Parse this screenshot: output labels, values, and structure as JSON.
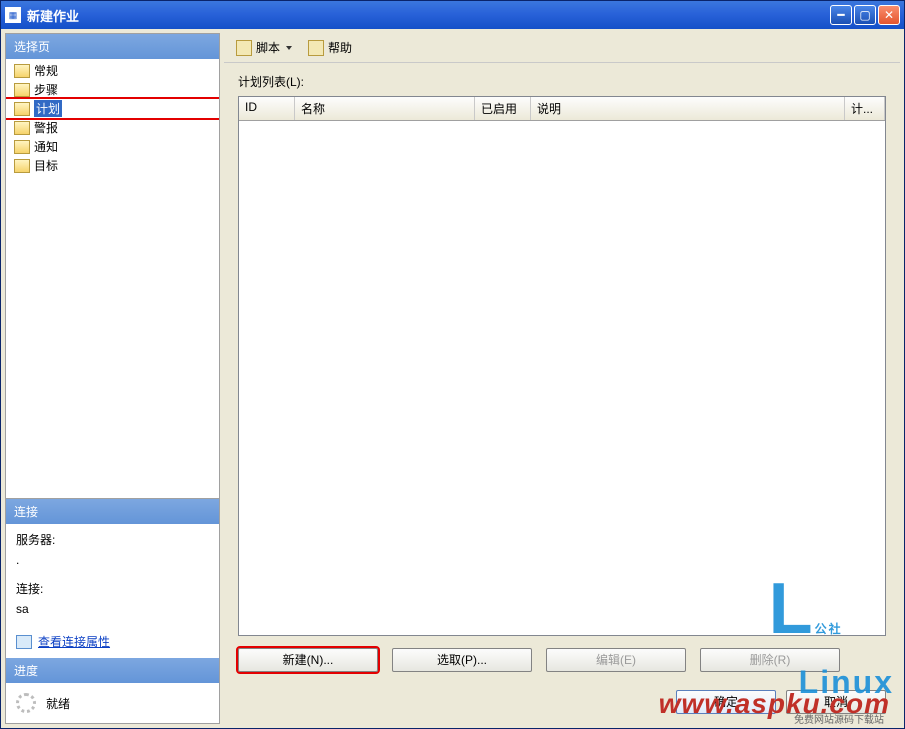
{
  "window": {
    "title": "新建作业"
  },
  "sidebar": {
    "select_header": "选择页",
    "items": [
      {
        "label": "常规"
      },
      {
        "label": "步骤"
      },
      {
        "label": "计划",
        "selected": true
      },
      {
        "label": "警报"
      },
      {
        "label": "通知"
      },
      {
        "label": "目标"
      }
    ],
    "conn_header": "连接",
    "server_label": "服务器:",
    "server_value": ".",
    "conn_label": "连接:",
    "conn_value": "sa",
    "view_conn": "查看连接属性",
    "prog_header": "进度",
    "prog_status": "就绪"
  },
  "toolbar": {
    "script": "脚本",
    "help": "帮助"
  },
  "content": {
    "list_label": "计划列表(L):",
    "columns": {
      "id": "ID",
      "name": "名称",
      "enabled": "已启用",
      "desc": "说明",
      "sched": "计..."
    },
    "buttons": {
      "new": "新建(N)...",
      "pick": "选取(P)...",
      "edit": "编辑(E)",
      "delete": "删除(R)"
    }
  },
  "footer": {
    "ok": "确定",
    "cancel": "取消"
  },
  "watermark": {
    "top": "公社",
    "brand": "Linux",
    "url": "www.aspku.com",
    "tag": "免费网站源码下载站"
  }
}
